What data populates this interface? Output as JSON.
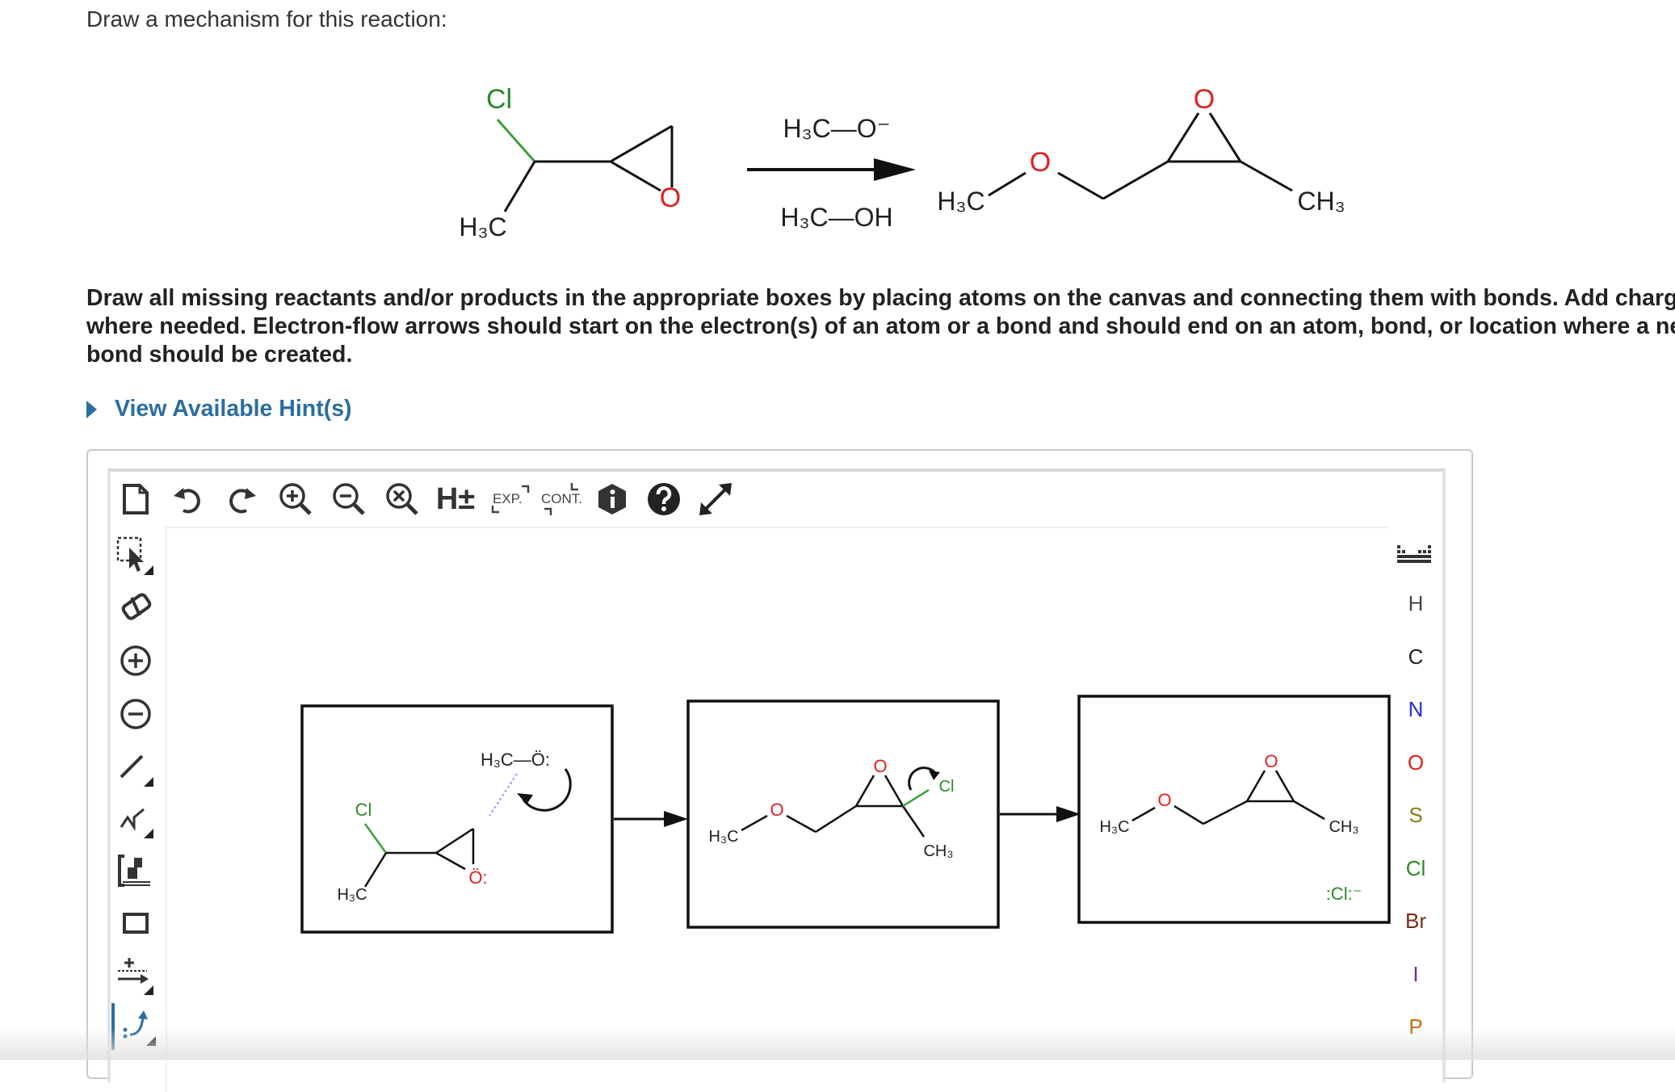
{
  "question": {
    "title": "Draw a mechanism for this reaction:",
    "instructions": [
      "Draw all missing reactants and/or products in the appropriate boxes by placing atoms on the canvas and connecting them with bonds. Add charges",
      "where needed. Electron-flow arrows should start on the electron(s) of an atom or a bond and should end on an atom, bond, or location where a new",
      "bond should be created."
    ],
    "hint_link": "View Available Hint(s)"
  },
  "reaction": {
    "reactant_cl": "Cl",
    "reactant_ch3": "H₃C",
    "reactant_o": "O",
    "reagent_top": "H₃C—O⁻",
    "reagent_bottom": "H₃C—OH",
    "product_h3c": "H₃C",
    "product_o_ether": "O",
    "product_o_epoxide": "O",
    "product_ch3": "CH₃"
  },
  "toolbar": {
    "hydrogen_label": "H±",
    "expand_label": "EXP.",
    "contract_label": "CONT."
  },
  "element_palette": [
    "H",
    "C",
    "N",
    "O",
    "S",
    "Cl",
    "Br",
    "I",
    "P"
  ],
  "element_colors": {
    "H": "#444444",
    "C": "#222222",
    "N": "#2b2bd6",
    "O": "#e02020",
    "S": "#8a7a10",
    "Cl": "#2a8a2a",
    "Br": "#7a2a1a",
    "I": "#6a2aa0",
    "P": "#c07010"
  },
  "canvas": {
    "box1": {
      "nucleophile": "H₃C—Ö:",
      "cl": "Cl",
      "ch3": "H₃C",
      "epoxide_o": "Ö:"
    },
    "box2": {
      "h3c": "H₃C",
      "ether_o": "O",
      "epoxide_o": "O",
      "cl": "Cl",
      "ch3": "CH₃"
    },
    "box3": {
      "h3c": "H₃C",
      "ether_o": "O",
      "epoxide_o": "O",
      "ch3": "CH₃",
      "chloride": ":Cl:⁻"
    }
  },
  "colors": {
    "link": "#2a6ea0",
    "oxygen": "#e02020",
    "chlorine": "#2a8a2a",
    "selected_tool": "#2a6ea0"
  }
}
